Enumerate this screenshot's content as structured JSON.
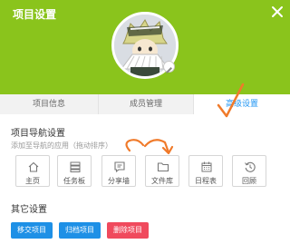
{
  "header": {
    "title": "项目设置",
    "close_icon": "close-icon",
    "background": "#8ac41c"
  },
  "avatar": {
    "edit_icon": "pencil-icon"
  },
  "tabs": [
    {
      "label": "项目信息",
      "active": false
    },
    {
      "label": "成员管理",
      "active": false
    },
    {
      "label": "高级设置",
      "active": true
    }
  ],
  "nav_settings": {
    "title": "项目导航设置",
    "subtitle": "添加至导航的应用（拖动排序）",
    "apps": [
      {
        "label": "主页",
        "icon": "home-icon"
      },
      {
        "label": "任务板",
        "icon": "task-board-icon"
      },
      {
        "label": "分享墙",
        "icon": "share-wall-icon"
      },
      {
        "label": "文件库",
        "icon": "folder-icon"
      },
      {
        "label": "日程表",
        "icon": "calendar-icon"
      },
      {
        "label": "回顾",
        "icon": "history-icon"
      }
    ]
  },
  "other_settings": {
    "title": "其它设置",
    "buttons": [
      {
        "label": "移交项目",
        "color": "#1e90e6"
      },
      {
        "label": "归档项目",
        "color": "#1e90e6"
      },
      {
        "label": "删除项目",
        "color": "#f04a5d"
      }
    ]
  },
  "colors": {
    "accent": "#2196f3",
    "annotation": "#f07a2a"
  }
}
